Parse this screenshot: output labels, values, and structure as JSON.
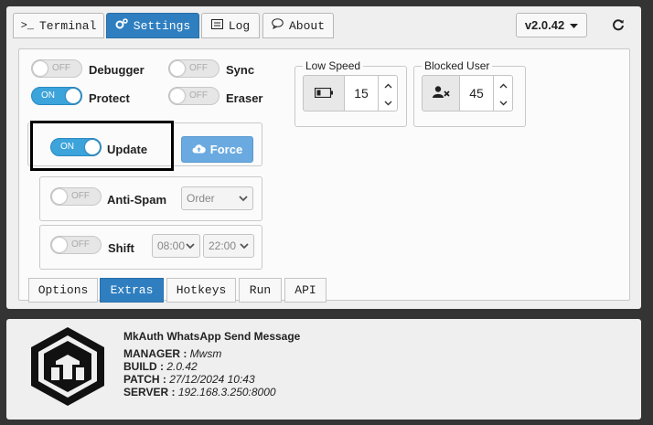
{
  "tabs": {
    "terminal": "Terminal",
    "settings": "Settings",
    "log": "Log",
    "about": "About"
  },
  "version": {
    "label": "v2.0.42"
  },
  "toggles": {
    "debugger": {
      "label": "Debugger",
      "state": "OFF"
    },
    "sync": {
      "label": "Sync",
      "state": "OFF"
    },
    "protect": {
      "label": "Protect",
      "state": "ON"
    },
    "eraser": {
      "label": "Eraser",
      "state": "OFF"
    },
    "update": {
      "label": "Update",
      "state": "ON"
    },
    "antispam": {
      "label": "Anti-Spam",
      "state": "OFF"
    },
    "shift": {
      "label": "Shift",
      "state": "OFF"
    }
  },
  "force_button": {
    "label": "Force"
  },
  "antispam_select": {
    "value": "Order"
  },
  "shift_selects": {
    "start": "08:00",
    "end": "22:00"
  },
  "low_speed": {
    "legend": "Low Speed",
    "value": "15"
  },
  "blocked_user": {
    "legend": "Blocked User",
    "value": "45"
  },
  "bottom_tabs": {
    "options": "Options",
    "extras": "Extras",
    "hotkeys": "Hotkeys",
    "run": "Run",
    "api": "API"
  },
  "about": {
    "title": "MkAuth WhatsApp Send Message",
    "manager_key": "MANAGER :",
    "manager_val": "Mwsm",
    "build_key": "BUILD :",
    "build_val": "2.0.42",
    "patch_key": "PATCH :",
    "patch_val": "27/12/2024 10:43",
    "server_key": "SERVER :",
    "server_val": "192.168.3.250:8000"
  },
  "colors": {
    "accent": "#2f7fc0",
    "toggle_on": "#3ca3db",
    "force": "#6aaae0",
    "background": "#343434"
  }
}
